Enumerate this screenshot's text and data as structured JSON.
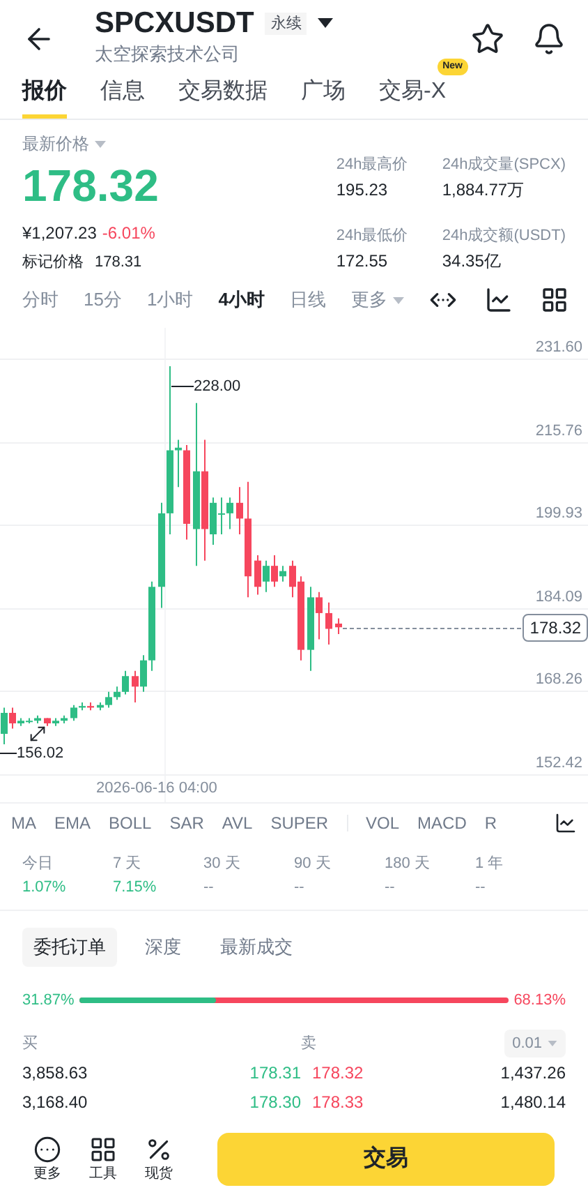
{
  "header": {
    "symbol": "SPCXUSDT",
    "contract_badge": "永续",
    "subtitle": "太空探索技术公司"
  },
  "tabs": [
    {
      "label": "报价",
      "selected": true
    },
    {
      "label": "信息",
      "selected": false
    },
    {
      "label": "交易数据",
      "selected": false
    },
    {
      "label": "广场",
      "selected": false
    },
    {
      "label": "交易-X",
      "selected": false,
      "badge": "New"
    }
  ],
  "price": {
    "label": "最新价格",
    "last": "178.32",
    "cny": "¥1,207.23",
    "change": "-6.01%",
    "mark_label": "标记价格",
    "mark": "178.31"
  },
  "stats": [
    {
      "label": "24h最高价",
      "value": "195.23"
    },
    {
      "label": "24h成交量(SPCX)",
      "value": "1,884.77万"
    },
    {
      "label": "24h最低价",
      "value": "172.55"
    },
    {
      "label": "24h成交额(USDT)",
      "value": "34.35亿"
    }
  ],
  "intervals": [
    {
      "label": "分时",
      "selected": false,
      "kind": "plain"
    },
    {
      "label": "15分",
      "selected": false,
      "kind": "plain"
    },
    {
      "label": "1小时",
      "selected": false,
      "kind": "plain"
    },
    {
      "label": "4小时",
      "selected": true,
      "kind": "plain"
    },
    {
      "label": "日线",
      "selected": false,
      "kind": "plain"
    },
    {
      "label": "更多",
      "selected": false,
      "kind": "dropdown"
    }
  ],
  "chart": {
    "y_ticks": [
      "231.60",
      "215.76",
      "199.93",
      "184.09",
      "168.26",
      "152.42"
    ],
    "high_label": "228.00",
    "low_label": "156.02",
    "current_price": "178.32",
    "date": "2026-06-16 04:00"
  },
  "indicators": [
    "MA",
    "EMA",
    "BOLL",
    "SAR",
    "AVL",
    "SUPER",
    "VOL",
    "MACD",
    "R"
  ],
  "periods": [
    {
      "label": "今日",
      "value": "1.07%",
      "color": "#2ebd85"
    },
    {
      "label": "7 天",
      "value": "7.15%",
      "color": "#2ebd85"
    },
    {
      "label": "30 天",
      "value": "--",
      "color": "#848e9c"
    },
    {
      "label": "90 天",
      "value": "--",
      "color": "#848e9c"
    },
    {
      "label": "180 天",
      "value": "--",
      "color": "#848e9c"
    },
    {
      "label": "1 年",
      "value": "--",
      "color": "#848e9c"
    }
  ],
  "book_tabs": [
    {
      "label": "委托订单",
      "selected": true
    },
    {
      "label": "深度",
      "selected": false
    },
    {
      "label": "最新成交",
      "selected": false
    }
  ],
  "ratio": {
    "buy": "31.87%",
    "sell": "68.13%",
    "level": 0.3187
  },
  "book": {
    "buy_label": "买",
    "sell_label": "卖",
    "precision": "0.01",
    "rows": [
      {
        "bid_qty": "3,858.63",
        "bid": "178.31",
        "ask": "178.32",
        "ask_qty": "1,437.26"
      },
      {
        "bid_qty": "3,168.40",
        "bid": "178.30",
        "ask": "178.33",
        "ask_qty": "1,480.14"
      }
    ]
  },
  "bottom_bar": {
    "actions": [
      {
        "label": "更多"
      },
      {
        "label": "工具"
      },
      {
        "label": "现货"
      }
    ],
    "trade_button": "交易"
  }
}
